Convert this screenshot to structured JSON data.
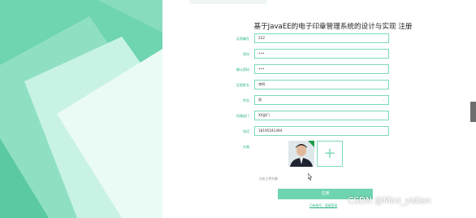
{
  "form": {
    "title": "基于JavaEE的电子印章管理系统的设计与实现 注册",
    "fields": [
      {
        "label": "证照编号",
        "value": "222"
      },
      {
        "label": "密码",
        "value": "•••"
      },
      {
        "label": "确认密码",
        "value": "•••"
      },
      {
        "label": "证照姓名",
        "value": "李四"
      },
      {
        "label": "性别",
        "value": "男"
      },
      {
        "label": "所属部门",
        "value": "XX部门"
      },
      {
        "label": "电话",
        "value": "18195541494"
      }
    ],
    "photo_label": "头像",
    "add_symbol": "+",
    "upload_hint": "点击上传头像",
    "register_label": "注册",
    "login_link": "已有账号，直接登录"
  },
  "watermark": "CSDN @Mini_yidian",
  "colors": {
    "accent": "#6fd4b0",
    "label": "#2cb38a",
    "border": "#7ed9bd"
  }
}
